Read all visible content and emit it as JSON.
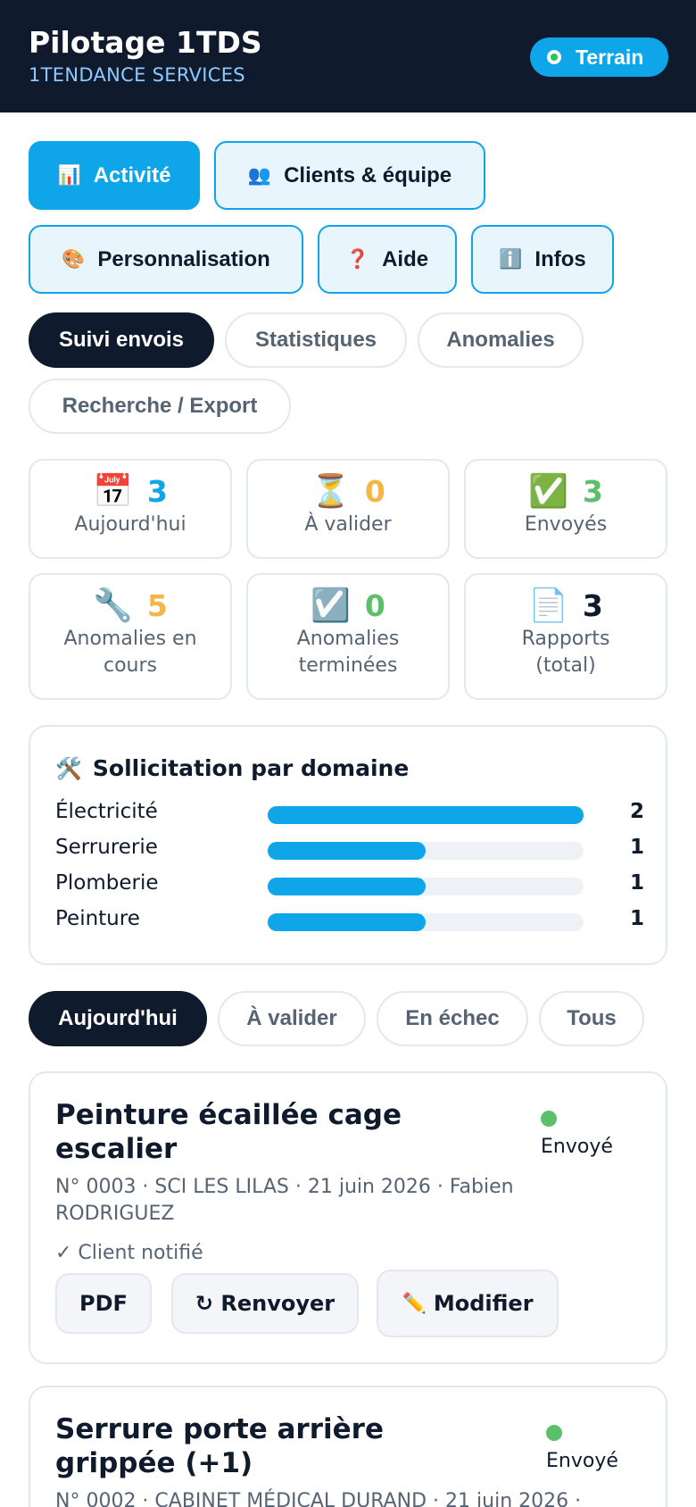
{
  "header": {
    "title": "Pilotage 1TDS",
    "subtitle": "1TENDANCE SERVICES",
    "mode_label": "Terrain"
  },
  "nav": [
    {
      "label": "Activité",
      "icon": "bar-chart-icon",
      "glyph": "📊"
    },
    {
      "label": "Clients & équipe",
      "icon": "people-icon",
      "glyph": "👥"
    },
    {
      "label": "Personnalisation",
      "icon": "palette-icon",
      "glyph": "🎨"
    },
    {
      "label": "Aide",
      "icon": "question-icon",
      "glyph": "❓"
    },
    {
      "label": "Infos",
      "icon": "info-icon",
      "glyph": "ℹ️"
    }
  ],
  "subnav": [
    "Suivi envois",
    "Statistiques",
    "Anomalies",
    "Recherche / Export"
  ],
  "stats": [
    {
      "value": "3",
      "label": "Aujourd'hui",
      "icon": "calendar-icon",
      "glyph": "📅",
      "color": "#0ea5e9"
    },
    {
      "value": "0",
      "label": "À valider",
      "icon": "hourglass-icon",
      "glyph": "⏳",
      "color": "#f6b544"
    },
    {
      "value": "3",
      "label": "Envoyés",
      "icon": "check-icon",
      "glyph": "✅",
      "color": "#5cc06a"
    },
    {
      "value": "5",
      "label": "Anomalies en cours",
      "icon": "wrench-icon",
      "glyph": "🔧",
      "color": "#f6b544"
    },
    {
      "value": "0",
      "label": "Anomalies terminées",
      "icon": "checkbox-icon",
      "glyph": "☑️",
      "color": "#5cc06a"
    },
    {
      "value": "3",
      "label": "Rapports (total)",
      "icon": "document-icon",
      "glyph": "📄",
      "color": "#0f1b2d"
    }
  ],
  "domains": {
    "title": "Sollicitation par domaine",
    "icon": "tools-icon",
    "glyph": "🛠️",
    "max": 2,
    "rows": [
      {
        "name": "Électricité",
        "count": 2
      },
      {
        "name": "Serrurerie",
        "count": 1
      },
      {
        "name": "Plomberie",
        "count": 1
      },
      {
        "name": "Peinture",
        "count": 1
      }
    ]
  },
  "filters": [
    "Aujourd'hui",
    "À valider",
    "En échec",
    "Tous"
  ],
  "reports": [
    {
      "title": "Peinture écaillée cage escalier",
      "status": "Envoyé",
      "meta": "N° 0003 · SCI LES LILAS · 21 juin 2026 · Fabien RODRIGUEZ",
      "notified": "✓ Client notifié",
      "actions": {
        "pdf": "PDF",
        "resend": "↻ Renvoyer",
        "edit": "Modifier",
        "edit_glyph": "✏️"
      }
    },
    {
      "title": "Serrure porte arrière grippée (+1)",
      "status": "Envoyé",
      "meta": "N° 0002 · CABINET MÉDICAL DURAND · 21 juin 2026 ·"
    }
  ]
}
